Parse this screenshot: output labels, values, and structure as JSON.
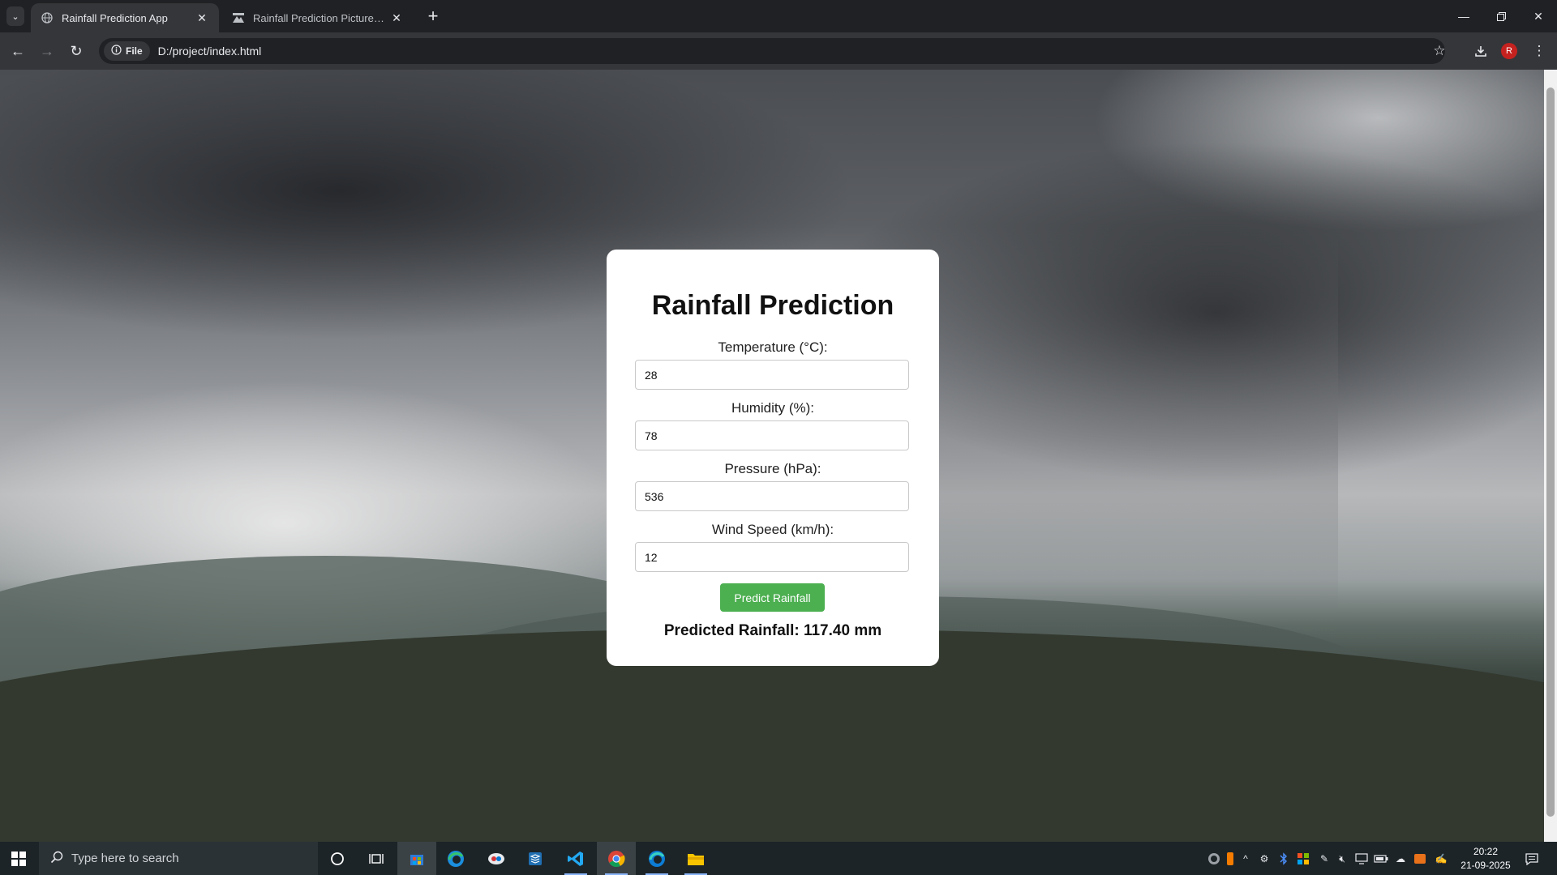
{
  "browser": {
    "tabs": [
      {
        "title": "Rainfall Prediction App",
        "active": true
      },
      {
        "title": "Rainfall Prediction Pictures | Do",
        "active": false
      }
    ],
    "address": {
      "chip_label": "File",
      "url": "D:/project/index.html"
    },
    "profile_initial": "R"
  },
  "page": {
    "title": "Rainfall Prediction",
    "fields": [
      {
        "label": "Temperature (°C):",
        "value": "28"
      },
      {
        "label": "Humidity (%):",
        "value": "78"
      },
      {
        "label": "Pressure (hPa):",
        "value": "536"
      },
      {
        "label": "Wind Speed (km/h):",
        "value": "12"
      }
    ],
    "button_label": "Predict Rainfall",
    "result_text": "Predicted Rainfall: 117.40 mm"
  },
  "taskbar": {
    "search_placeholder": "Type here to search",
    "time": "20:22",
    "date": "21-09-2025"
  },
  "colors": {
    "button": "#4caf50",
    "chrome_bg": "#202124",
    "toolbar_bg": "#35363a"
  }
}
